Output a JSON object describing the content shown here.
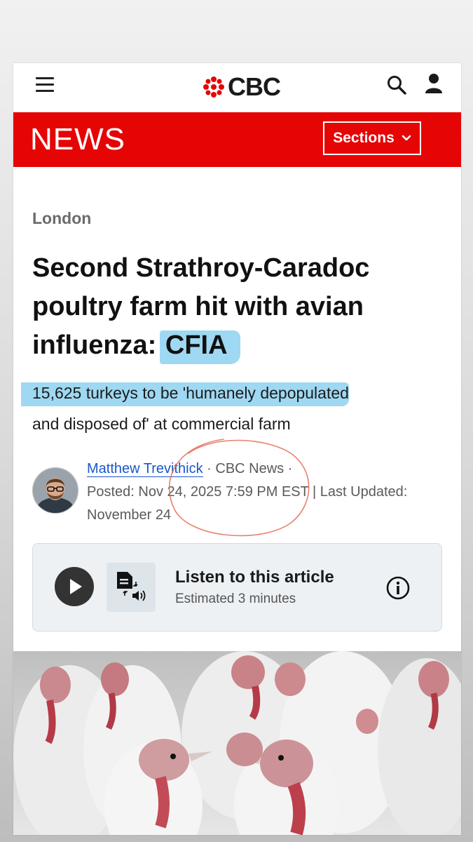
{
  "header": {
    "logo_text": "CBC",
    "section_title": "NEWS",
    "sections_label": "Sections"
  },
  "article": {
    "kicker": "London",
    "headline_main": "Second Strathroy-Caradoc poultry farm hit with avian influenza: ",
    "headline_highlight": "CFIA",
    "dek_highlight": "15,625 turkeys to be 'humanely depopulated",
    "dek_rest": "and disposed of' at commercial farm",
    "author": "Matthew Trevithick",
    "source": "· CBC News ·",
    "posted": "Posted: Nov 24, 2025 7:59 PM EST | Last Updated: November 24"
  },
  "audio": {
    "title": "Listen to this article",
    "subtitle": "Estimated 3 minutes"
  },
  "colors": {
    "brand_red": "#e60505",
    "highlight_blue": "#9fd8f2",
    "link_blue": "#1a57c9"
  },
  "icons": [
    "menu-icon",
    "cbc-gem-icon",
    "search-icon",
    "user-icon",
    "chevron-down-icon",
    "play-icon",
    "text-to-speech-icon",
    "info-icon"
  ]
}
